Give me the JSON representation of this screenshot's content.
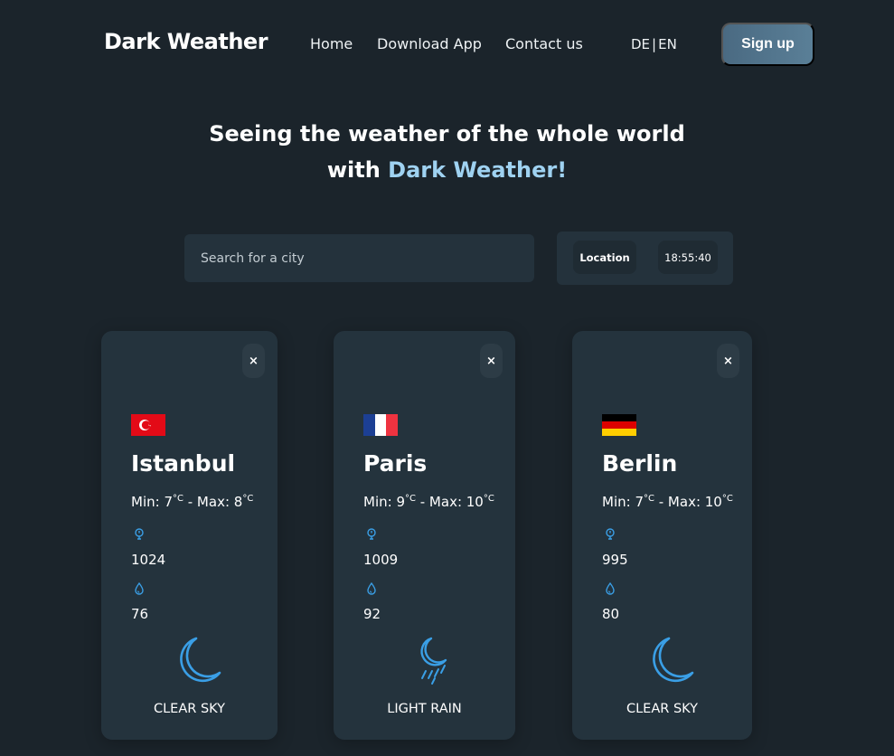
{
  "nav": {
    "brand": "Dark Weather",
    "links": [
      "Home",
      "Download App",
      "Contact us"
    ],
    "lang": {
      "de": "DE",
      "sep": "|",
      "en": "EN"
    },
    "signup_label": "Sign up"
  },
  "hero": {
    "line1": "Seeing the weather of the whole world",
    "line2_prefix": "with ",
    "line2_accent": "Dark Weather!"
  },
  "search": {
    "placeholder": "Search for a city",
    "value": ""
  },
  "info": {
    "location_label": "Location",
    "time": "18:55:40"
  },
  "cards": [
    {
      "city": "Istanbul",
      "flag": "turkey-flag",
      "min_label": "Min: ",
      "min": "7",
      "max_label": " - Max: ",
      "max": "8",
      "unit": "°C",
      "pressure": "1024",
      "humidity": "76",
      "condition": "CLEAR SKY",
      "weather_icon": "moon-icon",
      "close_label": "×"
    },
    {
      "city": "Paris",
      "flag": "france-flag",
      "min_label": "Min: ",
      "min": "9",
      "max_label": " - Max: ",
      "max": "10",
      "unit": "°C",
      "pressure": "1009",
      "humidity": "92",
      "condition": "LIGHT RAIN",
      "weather_icon": "moon-rain-icon",
      "close_label": "×"
    },
    {
      "city": "Berlin",
      "flag": "germany-flag",
      "min_label": "Min: ",
      "min": "7",
      "max_label": " - Max: ",
      "max": "10",
      "unit": "°C",
      "pressure": "995",
      "humidity": "80",
      "condition": "CLEAR SKY",
      "weather_icon": "moon-icon",
      "close_label": "×"
    }
  ],
  "colors": {
    "background": "#1b242b",
    "card": "#24333d",
    "accent": "#9fd2f1",
    "icon_blue": "#3a9fe6"
  }
}
